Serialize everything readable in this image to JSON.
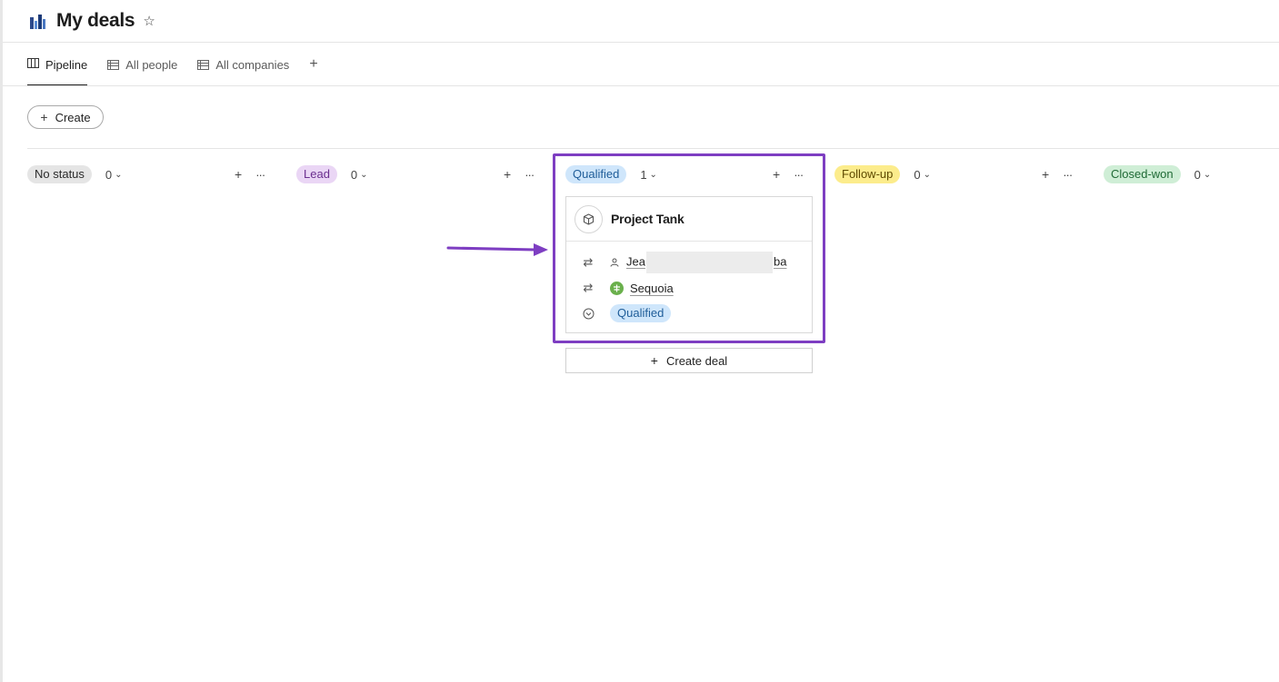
{
  "header": {
    "title": "My deals",
    "app_icon": "bar-chart-app-icon",
    "star_icon": "☆"
  },
  "tabs": [
    {
      "label": "Pipeline",
      "icon": "kanban-icon",
      "active": true
    },
    {
      "label": "All people",
      "icon": "table-icon",
      "active": false
    },
    {
      "label": "All companies",
      "icon": "table-icon",
      "active": false
    }
  ],
  "tab_add": "+",
  "toolbar": {
    "create_label": "Create"
  },
  "columns": [
    {
      "label": "No status",
      "count": "0",
      "bg": "#e5e5e5",
      "fg": "#2b2b2b"
    },
    {
      "label": "Lead",
      "count": "0",
      "bg": "#ead6f5",
      "fg": "#6b2f8f"
    },
    {
      "label": "Qualified",
      "count": "1",
      "bg": "#cfe6fb",
      "fg": "#1f5d99"
    },
    {
      "label": "Follow-up",
      "count": "0",
      "bg": "#fcec8c",
      "fg": "#5f4b00"
    },
    {
      "label": "Closed-won",
      "count": "0",
      "bg": "#cfeed6",
      "fg": "#1f6a35"
    }
  ],
  "card": {
    "title": "Project Tank",
    "person_prefix": "Jea",
    "person_suffix": "ba",
    "company": "Sequoia",
    "status": "Qualified"
  },
  "create_deal_label": "Create deal",
  "colors": {
    "highlight": "#7e3ec2",
    "arrow": "#7e3ec2",
    "company_dot": "#6ab04c"
  }
}
